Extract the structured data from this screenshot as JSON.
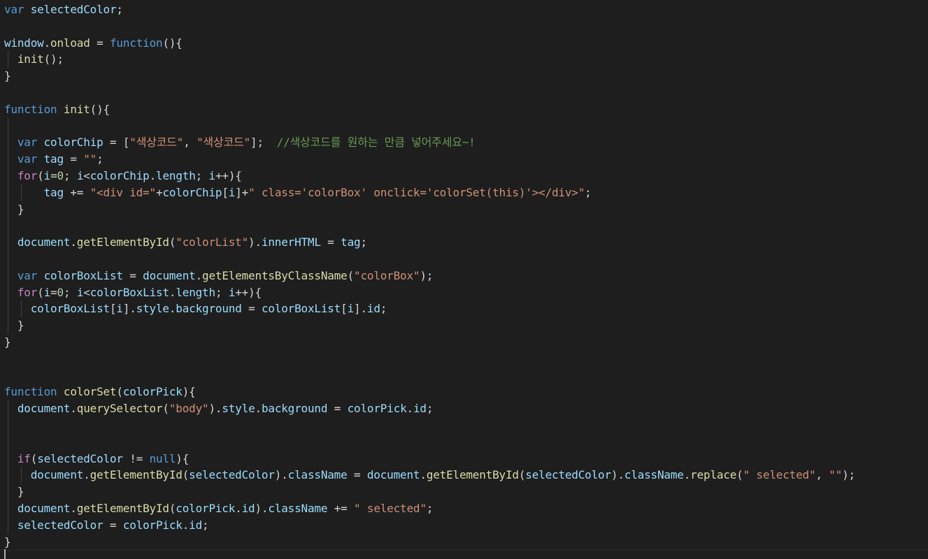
{
  "editor": {
    "language": "javascript",
    "theme_colors": {
      "background": "#1e1e1e",
      "keyword": "#569cd6",
      "control": "#c586c0",
      "function": "#dcdcaa",
      "variable": "#9cdcfe",
      "string": "#ce9178",
      "number": "#b5cea8",
      "comment": "#6a9955",
      "punctuation": "#d4d4d4"
    },
    "lines": [
      {
        "indent": 0,
        "tokens": [
          [
            "kw",
            "var"
          ],
          [
            "pn",
            " "
          ],
          [
            "vr",
            "selectedColor"
          ],
          [
            "pn",
            ";"
          ]
        ]
      },
      {
        "indent": 0,
        "tokens": []
      },
      {
        "indent": 0,
        "tokens": [
          [
            "vr",
            "window"
          ],
          [
            "pn",
            "."
          ],
          [
            "fn",
            "onload"
          ],
          [
            "pn",
            " = "
          ],
          [
            "kw",
            "function"
          ],
          [
            "pn",
            "(){"
          ]
        ]
      },
      {
        "indent": 1,
        "tokens": [
          [
            "pn",
            "  "
          ],
          [
            "fn",
            "init"
          ],
          [
            "pn",
            "();"
          ]
        ]
      },
      {
        "indent": 0,
        "tokens": [
          [
            "pn",
            "}"
          ]
        ]
      },
      {
        "indent": 0,
        "tokens": []
      },
      {
        "indent": 0,
        "tokens": [
          [
            "kw",
            "function"
          ],
          [
            "pn",
            " "
          ],
          [
            "fn",
            "init"
          ],
          [
            "pn",
            "(){"
          ]
        ]
      },
      {
        "indent": 1,
        "tokens": []
      },
      {
        "indent": 1,
        "tokens": [
          [
            "pn",
            "  "
          ],
          [
            "kw",
            "var"
          ],
          [
            "pn",
            " "
          ],
          [
            "vr",
            "colorChip"
          ],
          [
            "pn",
            " = ["
          ],
          [
            "str",
            "\"색상코드\""
          ],
          [
            "pn",
            ", "
          ],
          [
            "str",
            "\"색상코드\""
          ],
          [
            "pn",
            "];  "
          ],
          [
            "cmt",
            "//색상코드를 원하는 만큼 넣어주세요~!"
          ]
        ]
      },
      {
        "indent": 1,
        "tokens": [
          [
            "pn",
            "  "
          ],
          [
            "kw",
            "var"
          ],
          [
            "pn",
            " "
          ],
          [
            "vr",
            "tag"
          ],
          [
            "pn",
            " = "
          ],
          [
            "str",
            "\"\""
          ],
          [
            "pn",
            ";"
          ]
        ]
      },
      {
        "indent": 1,
        "tokens": [
          [
            "pn",
            "  "
          ],
          [
            "ctl",
            "for"
          ],
          [
            "pn",
            "("
          ],
          [
            "vr",
            "i"
          ],
          [
            "pn",
            "="
          ],
          [
            "num",
            "0"
          ],
          [
            "pn",
            "; "
          ],
          [
            "vr",
            "i"
          ],
          [
            "pn",
            "<"
          ],
          [
            "vr",
            "colorChip"
          ],
          [
            "pn",
            "."
          ],
          [
            "prop",
            "length"
          ],
          [
            "pn",
            "; "
          ],
          [
            "vr",
            "i"
          ],
          [
            "pn",
            "++){"
          ]
        ]
      },
      {
        "indent": 2,
        "tokens": [
          [
            "pn",
            "      "
          ],
          [
            "vr",
            "tag"
          ],
          [
            "pn",
            " += "
          ],
          [
            "str",
            "\"<div id=\""
          ],
          [
            "pn",
            "+"
          ],
          [
            "vr",
            "colorChip"
          ],
          [
            "pn",
            "["
          ],
          [
            "vr",
            "i"
          ],
          [
            "pn",
            "]+"
          ],
          [
            "str",
            "\" class='colorBox' onclick='colorSet(this)'></div>\""
          ],
          [
            "pn",
            ";"
          ]
        ]
      },
      {
        "indent": 1,
        "tokens": [
          [
            "pn",
            "  }"
          ]
        ]
      },
      {
        "indent": 1,
        "tokens": []
      },
      {
        "indent": 1,
        "tokens": [
          [
            "pn",
            "  "
          ],
          [
            "vr",
            "document"
          ],
          [
            "pn",
            "."
          ],
          [
            "fn",
            "getElementById"
          ],
          [
            "pn",
            "("
          ],
          [
            "str",
            "\"colorList\""
          ],
          [
            "pn",
            ")."
          ],
          [
            "prop",
            "innerHTML"
          ],
          [
            "pn",
            " = "
          ],
          [
            "vr",
            "tag"
          ],
          [
            "pn",
            ";"
          ]
        ]
      },
      {
        "indent": 1,
        "tokens": []
      },
      {
        "indent": 1,
        "tokens": [
          [
            "pn",
            "  "
          ],
          [
            "kw",
            "var"
          ],
          [
            "pn",
            " "
          ],
          [
            "vr",
            "colorBoxList"
          ],
          [
            "pn",
            " = "
          ],
          [
            "vr",
            "document"
          ],
          [
            "pn",
            "."
          ],
          [
            "fn",
            "getElementsByClassName"
          ],
          [
            "pn",
            "("
          ],
          [
            "str",
            "\"colorBox\""
          ],
          [
            "pn",
            ");"
          ]
        ]
      },
      {
        "indent": 1,
        "tokens": [
          [
            "pn",
            "  "
          ],
          [
            "ctl",
            "for"
          ],
          [
            "pn",
            "("
          ],
          [
            "vr",
            "i"
          ],
          [
            "pn",
            "="
          ],
          [
            "num",
            "0"
          ],
          [
            "pn",
            "; "
          ],
          [
            "vr",
            "i"
          ],
          [
            "pn",
            "<"
          ],
          [
            "vr",
            "colorBoxList"
          ],
          [
            "pn",
            "."
          ],
          [
            "prop",
            "length"
          ],
          [
            "pn",
            "; "
          ],
          [
            "vr",
            "i"
          ],
          [
            "pn",
            "++){"
          ]
        ]
      },
      {
        "indent": 2,
        "tokens": [
          [
            "pn",
            "    "
          ],
          [
            "vr",
            "colorBoxList"
          ],
          [
            "pn",
            "["
          ],
          [
            "vr",
            "i"
          ],
          [
            "pn",
            "]."
          ],
          [
            "prop",
            "style"
          ],
          [
            "pn",
            "."
          ],
          [
            "prop",
            "background"
          ],
          [
            "pn",
            " = "
          ],
          [
            "vr",
            "colorBoxList"
          ],
          [
            "pn",
            "["
          ],
          [
            "vr",
            "i"
          ],
          [
            "pn",
            "]."
          ],
          [
            "prop",
            "id"
          ],
          [
            "pn",
            ";"
          ]
        ]
      },
      {
        "indent": 1,
        "tokens": [
          [
            "pn",
            "  }"
          ]
        ]
      },
      {
        "indent": 0,
        "tokens": [
          [
            "pn",
            "}"
          ]
        ]
      },
      {
        "indent": 0,
        "tokens": []
      },
      {
        "indent": 0,
        "tokens": []
      },
      {
        "indent": 0,
        "tokens": [
          [
            "kw",
            "function"
          ],
          [
            "pn",
            " "
          ],
          [
            "fn",
            "colorSet"
          ],
          [
            "pn",
            "("
          ],
          [
            "vr",
            "colorPick"
          ],
          [
            "pn",
            "){"
          ]
        ]
      },
      {
        "indent": 1,
        "tokens": [
          [
            "pn",
            "  "
          ],
          [
            "vr",
            "document"
          ],
          [
            "pn",
            "."
          ],
          [
            "fn",
            "querySelector"
          ],
          [
            "pn",
            "("
          ],
          [
            "str",
            "\"body\""
          ],
          [
            "pn",
            ")."
          ],
          [
            "prop",
            "style"
          ],
          [
            "pn",
            "."
          ],
          [
            "prop",
            "background"
          ],
          [
            "pn",
            " = "
          ],
          [
            "vr",
            "colorPick"
          ],
          [
            "pn",
            "."
          ],
          [
            "prop",
            "id"
          ],
          [
            "pn",
            ";"
          ]
        ]
      },
      {
        "indent": 1,
        "tokens": []
      },
      {
        "indent": 1,
        "tokens": []
      },
      {
        "indent": 1,
        "tokens": [
          [
            "pn",
            "  "
          ],
          [
            "ctl",
            "if"
          ],
          [
            "pn",
            "("
          ],
          [
            "vr",
            "selectedColor"
          ],
          [
            "pn",
            " != "
          ],
          [
            "kw",
            "null"
          ],
          [
            "pn",
            "){"
          ]
        ]
      },
      {
        "indent": 2,
        "tokens": [
          [
            "pn",
            "    "
          ],
          [
            "vr",
            "document"
          ],
          [
            "pn",
            "."
          ],
          [
            "fn",
            "getElementById"
          ],
          [
            "pn",
            "("
          ],
          [
            "vr",
            "selectedColor"
          ],
          [
            "pn",
            ")."
          ],
          [
            "prop",
            "className"
          ],
          [
            "pn",
            " = "
          ],
          [
            "vr",
            "document"
          ],
          [
            "pn",
            "."
          ],
          [
            "fn",
            "getElementById"
          ],
          [
            "pn",
            "("
          ],
          [
            "vr",
            "selectedColor"
          ],
          [
            "pn",
            ")."
          ],
          [
            "prop",
            "className"
          ],
          [
            "pn",
            "."
          ],
          [
            "fn",
            "replace"
          ],
          [
            "pn",
            "("
          ],
          [
            "str",
            "\" selected\""
          ],
          [
            "pn",
            ", "
          ],
          [
            "str",
            "\"\""
          ],
          [
            "pn",
            ");"
          ]
        ]
      },
      {
        "indent": 1,
        "tokens": [
          [
            "pn",
            "  }"
          ]
        ]
      },
      {
        "indent": 1,
        "tokens": [
          [
            "pn",
            "  "
          ],
          [
            "vr",
            "document"
          ],
          [
            "pn",
            "."
          ],
          [
            "fn",
            "getElementById"
          ],
          [
            "pn",
            "("
          ],
          [
            "vr",
            "colorPick"
          ],
          [
            "pn",
            "."
          ],
          [
            "prop",
            "id"
          ],
          [
            "pn",
            ")."
          ],
          [
            "prop",
            "className"
          ],
          [
            "pn",
            " += "
          ],
          [
            "str",
            "\" selected\""
          ],
          [
            "pn",
            ";"
          ]
        ]
      },
      {
        "indent": 1,
        "tokens": [
          [
            "pn",
            "  "
          ],
          [
            "vr",
            "selectedColor"
          ],
          [
            "pn",
            " = "
          ],
          [
            "vr",
            "colorPick"
          ],
          [
            "pn",
            "."
          ],
          [
            "prop",
            "id"
          ],
          [
            "pn",
            ";"
          ]
        ]
      },
      {
        "indent": 0,
        "tokens": [
          [
            "pn",
            "}"
          ]
        ]
      }
    ]
  }
}
